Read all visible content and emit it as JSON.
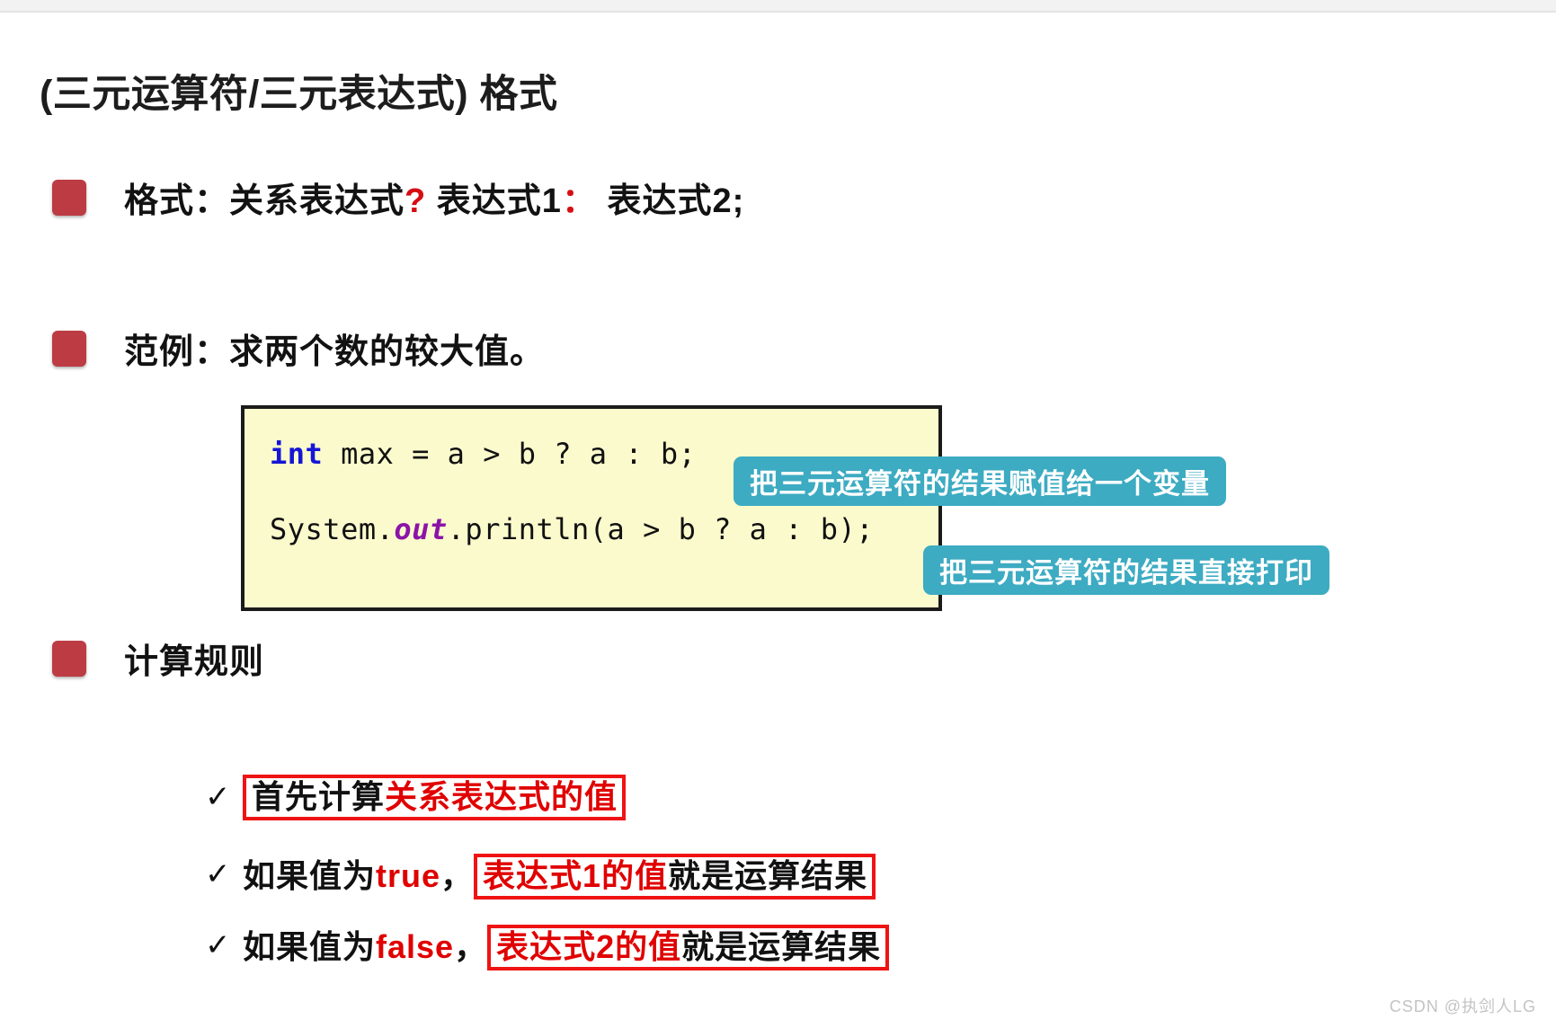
{
  "slide": {
    "title": "(三元运算符/三元表达式) 格式",
    "bullets": [
      {
        "id": "format",
        "label_prefix": "格式：关系表达式",
        "sym1": "?",
        "label_mid": " 表达式1",
        "sym2": "：",
        "label_suffix": " 表达式2;"
      },
      {
        "id": "example",
        "text": "范例：求两个数的较大值。"
      },
      {
        "id": "rule",
        "text": "计算规则"
      }
    ],
    "code": {
      "line1": {
        "kw": "int",
        "rest": " max = a > b ? a : b;"
      },
      "line2": {
        "prefix": "System.",
        "kw": "out",
        "rest": ".println(a > b ? a : b);"
      }
    },
    "callouts": [
      {
        "id": "assign",
        "text": "把三元运算符的结果赋值给一个变量"
      },
      {
        "id": "print",
        "text": "把三元运算符的结果直接打印"
      }
    ],
    "rules": [
      {
        "id": "rule-1",
        "check": "✓",
        "boxed_black": "首先计算",
        "boxed_red": "关系表达式的值",
        "trailing": ""
      },
      {
        "id": "rule-2",
        "check": "✓",
        "lead_black": "如果值为",
        "lead_red": "true",
        "lead_comma": "，",
        "boxed_red": "表达式1的值",
        "boxed_black": "就是运算结果"
      },
      {
        "id": "rule-3",
        "check": "✓",
        "lead_black": "如果值为",
        "lead_red": "false",
        "lead_comma": "，",
        "boxed_red": "表达式2的值",
        "boxed_black": "就是运算结果"
      }
    ],
    "watermark": "CSDN @执剑人LG",
    "colors": {
      "bullet_square": "#BD3B43",
      "callout_teal": "#3DABC2",
      "code_bg": "#FBFACD",
      "code_border": "#1B1B1B",
      "highlight_red": "#E00000",
      "box_red": "#EF1313",
      "keyword_blue": "#1515D6",
      "keyword_purple": "#8B14A8"
    }
  }
}
